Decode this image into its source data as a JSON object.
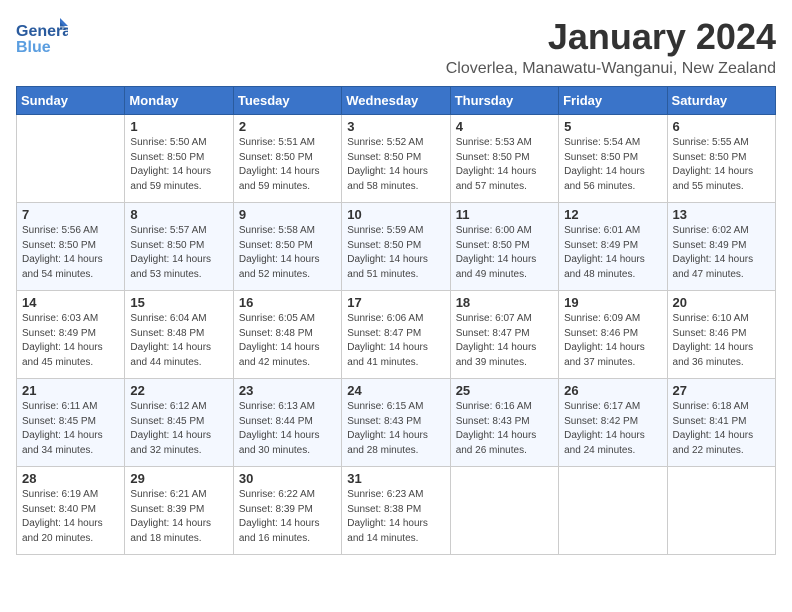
{
  "logo": {
    "text_general": "General",
    "text_blue": "Blue"
  },
  "title": "January 2024",
  "location": "Cloverlea, Manawatu-Wanganui, New Zealand",
  "days_of_week": [
    "Sunday",
    "Monday",
    "Tuesday",
    "Wednesday",
    "Thursday",
    "Friday",
    "Saturday"
  ],
  "weeks": [
    [
      {
        "day": "",
        "sunrise": "",
        "sunset": "",
        "daylight": ""
      },
      {
        "day": "1",
        "sunrise": "Sunrise: 5:50 AM",
        "sunset": "Sunset: 8:50 PM",
        "daylight": "Daylight: 14 hours and 59 minutes."
      },
      {
        "day": "2",
        "sunrise": "Sunrise: 5:51 AM",
        "sunset": "Sunset: 8:50 PM",
        "daylight": "Daylight: 14 hours and 59 minutes."
      },
      {
        "day": "3",
        "sunrise": "Sunrise: 5:52 AM",
        "sunset": "Sunset: 8:50 PM",
        "daylight": "Daylight: 14 hours and 58 minutes."
      },
      {
        "day": "4",
        "sunrise": "Sunrise: 5:53 AM",
        "sunset": "Sunset: 8:50 PM",
        "daylight": "Daylight: 14 hours and 57 minutes."
      },
      {
        "day": "5",
        "sunrise": "Sunrise: 5:54 AM",
        "sunset": "Sunset: 8:50 PM",
        "daylight": "Daylight: 14 hours and 56 minutes."
      },
      {
        "day": "6",
        "sunrise": "Sunrise: 5:55 AM",
        "sunset": "Sunset: 8:50 PM",
        "daylight": "Daylight: 14 hours and 55 minutes."
      }
    ],
    [
      {
        "day": "7",
        "sunrise": "Sunrise: 5:56 AM",
        "sunset": "Sunset: 8:50 PM",
        "daylight": "Daylight: 14 hours and 54 minutes."
      },
      {
        "day": "8",
        "sunrise": "Sunrise: 5:57 AM",
        "sunset": "Sunset: 8:50 PM",
        "daylight": "Daylight: 14 hours and 53 minutes."
      },
      {
        "day": "9",
        "sunrise": "Sunrise: 5:58 AM",
        "sunset": "Sunset: 8:50 PM",
        "daylight": "Daylight: 14 hours and 52 minutes."
      },
      {
        "day": "10",
        "sunrise": "Sunrise: 5:59 AM",
        "sunset": "Sunset: 8:50 PM",
        "daylight": "Daylight: 14 hours and 51 minutes."
      },
      {
        "day": "11",
        "sunrise": "Sunrise: 6:00 AM",
        "sunset": "Sunset: 8:50 PM",
        "daylight": "Daylight: 14 hours and 49 minutes."
      },
      {
        "day": "12",
        "sunrise": "Sunrise: 6:01 AM",
        "sunset": "Sunset: 8:49 PM",
        "daylight": "Daylight: 14 hours and 48 minutes."
      },
      {
        "day": "13",
        "sunrise": "Sunrise: 6:02 AM",
        "sunset": "Sunset: 8:49 PM",
        "daylight": "Daylight: 14 hours and 47 minutes."
      }
    ],
    [
      {
        "day": "14",
        "sunrise": "Sunrise: 6:03 AM",
        "sunset": "Sunset: 8:49 PM",
        "daylight": "Daylight: 14 hours and 45 minutes."
      },
      {
        "day": "15",
        "sunrise": "Sunrise: 6:04 AM",
        "sunset": "Sunset: 8:48 PM",
        "daylight": "Daylight: 14 hours and 44 minutes."
      },
      {
        "day": "16",
        "sunrise": "Sunrise: 6:05 AM",
        "sunset": "Sunset: 8:48 PM",
        "daylight": "Daylight: 14 hours and 42 minutes."
      },
      {
        "day": "17",
        "sunrise": "Sunrise: 6:06 AM",
        "sunset": "Sunset: 8:47 PM",
        "daylight": "Daylight: 14 hours and 41 minutes."
      },
      {
        "day": "18",
        "sunrise": "Sunrise: 6:07 AM",
        "sunset": "Sunset: 8:47 PM",
        "daylight": "Daylight: 14 hours and 39 minutes."
      },
      {
        "day": "19",
        "sunrise": "Sunrise: 6:09 AM",
        "sunset": "Sunset: 8:46 PM",
        "daylight": "Daylight: 14 hours and 37 minutes."
      },
      {
        "day": "20",
        "sunrise": "Sunrise: 6:10 AM",
        "sunset": "Sunset: 8:46 PM",
        "daylight": "Daylight: 14 hours and 36 minutes."
      }
    ],
    [
      {
        "day": "21",
        "sunrise": "Sunrise: 6:11 AM",
        "sunset": "Sunset: 8:45 PM",
        "daylight": "Daylight: 14 hours and 34 minutes."
      },
      {
        "day": "22",
        "sunrise": "Sunrise: 6:12 AM",
        "sunset": "Sunset: 8:45 PM",
        "daylight": "Daylight: 14 hours and 32 minutes."
      },
      {
        "day": "23",
        "sunrise": "Sunrise: 6:13 AM",
        "sunset": "Sunset: 8:44 PM",
        "daylight": "Daylight: 14 hours and 30 minutes."
      },
      {
        "day": "24",
        "sunrise": "Sunrise: 6:15 AM",
        "sunset": "Sunset: 8:43 PM",
        "daylight": "Daylight: 14 hours and 28 minutes."
      },
      {
        "day": "25",
        "sunrise": "Sunrise: 6:16 AM",
        "sunset": "Sunset: 8:43 PM",
        "daylight": "Daylight: 14 hours and 26 minutes."
      },
      {
        "day": "26",
        "sunrise": "Sunrise: 6:17 AM",
        "sunset": "Sunset: 8:42 PM",
        "daylight": "Daylight: 14 hours and 24 minutes."
      },
      {
        "day": "27",
        "sunrise": "Sunrise: 6:18 AM",
        "sunset": "Sunset: 8:41 PM",
        "daylight": "Daylight: 14 hours and 22 minutes."
      }
    ],
    [
      {
        "day": "28",
        "sunrise": "Sunrise: 6:19 AM",
        "sunset": "Sunset: 8:40 PM",
        "daylight": "Daylight: 14 hours and 20 minutes."
      },
      {
        "day": "29",
        "sunrise": "Sunrise: 6:21 AM",
        "sunset": "Sunset: 8:39 PM",
        "daylight": "Daylight: 14 hours and 18 minutes."
      },
      {
        "day": "30",
        "sunrise": "Sunrise: 6:22 AM",
        "sunset": "Sunset: 8:39 PM",
        "daylight": "Daylight: 14 hours and 16 minutes."
      },
      {
        "day": "31",
        "sunrise": "Sunrise: 6:23 AM",
        "sunset": "Sunset: 8:38 PM",
        "daylight": "Daylight: 14 hours and 14 minutes."
      },
      {
        "day": "",
        "sunrise": "",
        "sunset": "",
        "daylight": ""
      },
      {
        "day": "",
        "sunrise": "",
        "sunset": "",
        "daylight": ""
      },
      {
        "day": "",
        "sunrise": "",
        "sunset": "",
        "daylight": ""
      }
    ]
  ]
}
